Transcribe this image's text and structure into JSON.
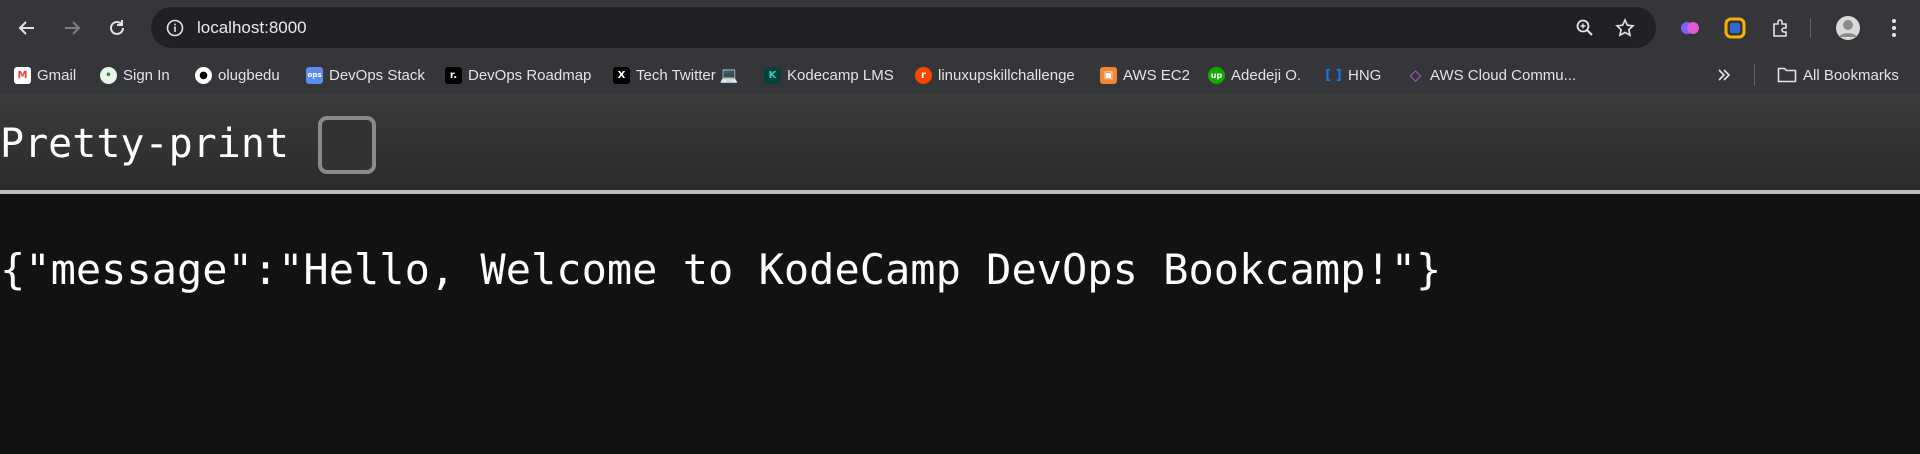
{
  "browser": {
    "url": "localhost:8000",
    "bookmarks": [
      {
        "label": "Gmail",
        "icon": "gmail-icon",
        "color": "#ea4335",
        "glyph": "M"
      },
      {
        "label": "Sign In",
        "icon": "sign-in-icon",
        "color": "#4caf50",
        "glyph": "•"
      },
      {
        "label": "olugbedu",
        "icon": "github-icon",
        "color": "#ffffff",
        "glyph": "●"
      },
      {
        "label": "DevOps Stack",
        "icon": "devops-stack-icon",
        "color": "#5b8def",
        "glyph": "ops"
      },
      {
        "label": "DevOps Roadmap",
        "icon": "roadmap-icon",
        "color": "#000000",
        "glyph": "r."
      },
      {
        "label": "Tech Twitter 💻",
        "icon": "x-twitter-icon",
        "color": "#000000",
        "glyph": "X"
      },
      {
        "label": "Kodecamp LMS",
        "icon": "kodecamp-icon",
        "color": "#0b3d3a",
        "glyph": "K"
      },
      {
        "label": "linuxupskillchallenge",
        "icon": "reddit-icon",
        "color": "#ff4500",
        "glyph": "r"
      },
      {
        "label": "AWS EC2",
        "icon": "aws-ec2-icon",
        "color": "#f58534",
        "glyph": "▣"
      },
      {
        "label": "Adedeji O.",
        "icon": "upwork-icon",
        "color": "#14a800",
        "glyph": "up"
      },
      {
        "label": "HNG",
        "icon": "hng-icon",
        "color": "#1a73e8",
        "glyph": "[ ]"
      },
      {
        "label": "AWS Cloud Commu...",
        "icon": "aws-cloud-community-icon",
        "color": "#a855f7",
        "glyph": "◇"
      }
    ],
    "all_bookmarks_label": "All Bookmarks"
  },
  "page": {
    "pretty_print_label": "Pretty-print",
    "pretty_print_checked": false,
    "json_text": "{\"message\":\"Hello, Welcome to KodeCamp DevOps Bookcamp!\"}"
  }
}
